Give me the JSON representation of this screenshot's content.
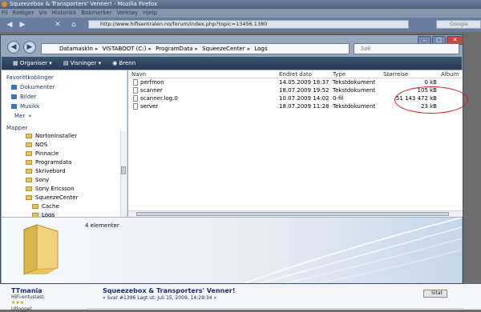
{
  "browser": {
    "title": "Squeezebox & Transporters' Venner! - Mozilla Firefox",
    "menu": [
      "Fil",
      "Rediger",
      "Vis",
      "Historikk",
      "Bokmerker",
      "Verktøy",
      "Hjelp"
    ],
    "url": "http://www.hifisentralen.no/forum/index.php?topic=13456.1380",
    "search_placeholder": "Google"
  },
  "explorer": {
    "breadcrumb": [
      "Datamaskin",
      "VISTABOOT (C:)",
      "ProgramData",
      "SqueezeCenter",
      "Logs"
    ],
    "search_placeholder": "Søk",
    "toolbar": {
      "organize": "Organiser",
      "views": "Visninger",
      "burn": "Brenn"
    },
    "favorites_header": "Favorittkoblinger",
    "favorites": [
      "Dokumenter",
      "Bilder",
      "Musikk"
    ],
    "more": "Mer",
    "folders_header": "Mapper",
    "tree": [
      "NortonInstaller",
      "NOS",
      "Pinnacle",
      "Programdata",
      "Skrivebord",
      "Sony",
      "Sony Ericsson",
      "SqueezeCenter",
      "Cache",
      "Logs"
    ],
    "columns": [
      "Navn",
      "Endret dato",
      "Type",
      "Størrelse",
      "Album"
    ],
    "files": [
      {
        "name": "perfmon",
        "date": "14.05.2009 18:37",
        "type": "Tekstdokument",
        "size": "0 kB"
      },
      {
        "name": "scanner",
        "date": "18.07.2009 19:52",
        "type": "Tekstdokument",
        "size": "105 kB"
      },
      {
        "name": "scanner.log.0",
        "date": "10.07.2009 14:02",
        "type": "0-fil",
        "size": "51 143 472 kB"
      },
      {
        "name": "server",
        "date": "18.07.2009 11:28",
        "type": "Tekstdokument",
        "size": "23 kB"
      }
    ],
    "item_count": "4 elementer"
  },
  "forum": {
    "user": "TTmania",
    "role": "HiFi-entusiast",
    "logged": "Utlogget",
    "post_title": "Squeezebox & Transporters' Venner!",
    "post_sub": "« Svar #1396 Lagt ut: juli 15, 2009, 14:29:34 »",
    "quote": "Sitat"
  },
  "colors": {
    "annotation": "#d41b1b",
    "toolbar": "#2c4260"
  }
}
